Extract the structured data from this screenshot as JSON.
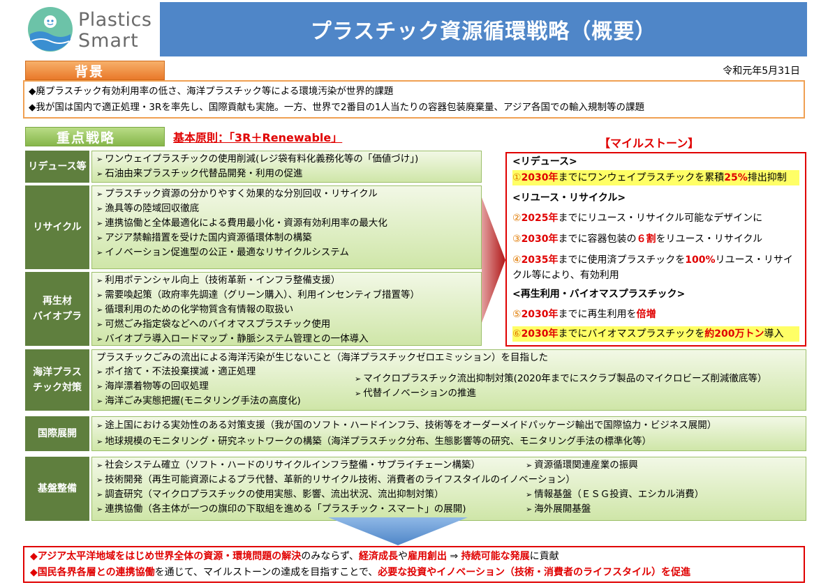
{
  "header": {
    "logo_line1": "Plastics",
    "logo_line2": "Smart",
    "title": "プラスチック資源循環戦略（概要）"
  },
  "background": {
    "tab": "背景",
    "date": "令和元年5月31日",
    "lines": [
      "◆廃プラスチック有効利用率の低さ、海洋プラスチック等による環境汚染が世界的課題",
      "◆我が国は国内で適正処理・3Rを率先し、国際貢献も実施。一方、世界で2番目の1人当たりの容器包装廃棄量、アジア各国での輸入規制等の課題"
    ]
  },
  "strategy": {
    "tab": "重点戦略",
    "principle": "基本原則：「3R＋Renewable」",
    "milestone_title": "【マイルストーン】",
    "rows": [
      {
        "label": "リデュース等",
        "items": [
          "ワンウェイプラスチックの使用削減(レジ袋有料化義務化等の「価値づけ」)",
          "石油由来プラスチック代替品開発・利用の促進"
        ]
      },
      {
        "label": "リサイクル",
        "items": [
          "プラスチック資源の分かりやすく効果的な分別回収・リサイクル",
          "漁具等の陸域回収徹底",
          "連携協働と全体最適化による費用最小化・資源有効利用率の最大化",
          "アジア禁輸措置を受けた国内資源循環体制の構築",
          "イノベーション促進型の公正・最適なリサイクルシステム"
        ]
      },
      {
        "label_line1": "再生材",
        "label_line2": "バイオプラ",
        "items": [
          "利用ポテンシャル向上（技術革新・インフラ整備支援）",
          "需要喚起策（政府率先調達（グリーン購入）、利用インセンティブ措置等）",
          "循環利用のための化学物質含有情報の取扱い",
          "可燃ごみ指定袋などへのバイオマスプラスチック使用",
          "バイオプラ導入ロードマップ・静脈システム管理との一体導入"
        ]
      },
      {
        "label_line1": "海洋プラス",
        "label_line2": "チック対策",
        "intro": "プラスチックごみの流出による海洋汚染が生じないこと（海洋プラスチックゼロエミッション）を目指した",
        "items_left": [
          "ポイ捨て・不法投棄撲滅・適正処理",
          "海岸漂着物等の回収処理",
          "海洋ごみ実態把握(モニタリング手法の高度化)"
        ],
        "items_right": [
          "マイクロプラスチック流出抑制対策(2020年までにスクラブ製品のマイクロビーズ削減徹底等）",
          "代替イノベーションの推進"
        ]
      },
      {
        "label": "国際展開",
        "items": [
          "途上国における実効性のある対策支援（我が国のソフト・ハードインフラ、技術等をオーダーメイドパッケージ輸出で国際協力・ビジネス展開）",
          "地球規模のモニタリング・研究ネットワークの構築（海洋プラスチック分布、生態影響等の研究、モニタリング手法の標準化等）"
        ]
      },
      {
        "label": "基盤整備",
        "items_left": [
          "社会システム確立（ソフト・ハードのリサイクルインフラ整備・サプライチェーン構築）",
          "技術開発（再生可能資源によるプラ代替、革新的リサイクル技術、消費者のライフスタイルのイノベーション）",
          "調査研究（マイクロプラスチックの使用実態、影響、流出状況、流出抑制対策）",
          "連携協働（各主体が一つの旗印の下取組を進める「プラスチック・スマート」の展開)"
        ],
        "items_right": [
          "資源循環関連産業の振興",
          "情報基盤（ＥＳＧ投資、エシカル消費）",
          "海外展開基盤"
        ]
      }
    ]
  },
  "milestones": {
    "reduce_head": "<リデュース>",
    "m1": {
      "num": "①",
      "year": "2030年",
      "t1": "までにワンウェイプラスチックを累積",
      "pct": "25%",
      "t2": "排出抑制"
    },
    "reuse_head": "<リユース・リサイクル>",
    "m2": {
      "num": "②",
      "year": "2025年",
      "t1": "までにリユース・リサイクル可能なデザインに"
    },
    "m3": {
      "num": "③",
      "year": "2030年",
      "t1": "までに容器包装の",
      "pct": "６割",
      "t2": "をリユース・リサイクル"
    },
    "m4": {
      "num": "④",
      "year": "2035年",
      "t1": "までに使用済プラスチックを",
      "pct": "100%",
      "t2": "リユース・リサイクル等により、有効利用"
    },
    "bio_head": "<再生利用・バイオマスプラスチック>",
    "m5": {
      "num": "⑤",
      "year": "2030年",
      "t1": "までに再生利用を",
      "pct": "倍増"
    },
    "m6": {
      "num": "⑥",
      "year": "2030年",
      "t1": "までにバイオマスプラスチックを",
      "pct": "約200万トン",
      "t2": "導入"
    }
  },
  "bottom": {
    "l1a": "◆アジア太平洋地域をはじめ世界全体の資源・環境問題の解決",
    "l1b": "のみならず、",
    "l1c": "経済成長",
    "l1d": "や",
    "l1e": "雇用創出",
    "l1f": " ⇒ ",
    "l1g": "持続可能な発展",
    "l1h": "に貢献",
    "l2a": "◆国民各界各層との連携協働",
    "l2b": "を通じて、マイルストーンの達成を目指すことで、",
    "l2c": "必要な投資やイノベーション（技術・消費者のライフスタイル）を促進"
  }
}
